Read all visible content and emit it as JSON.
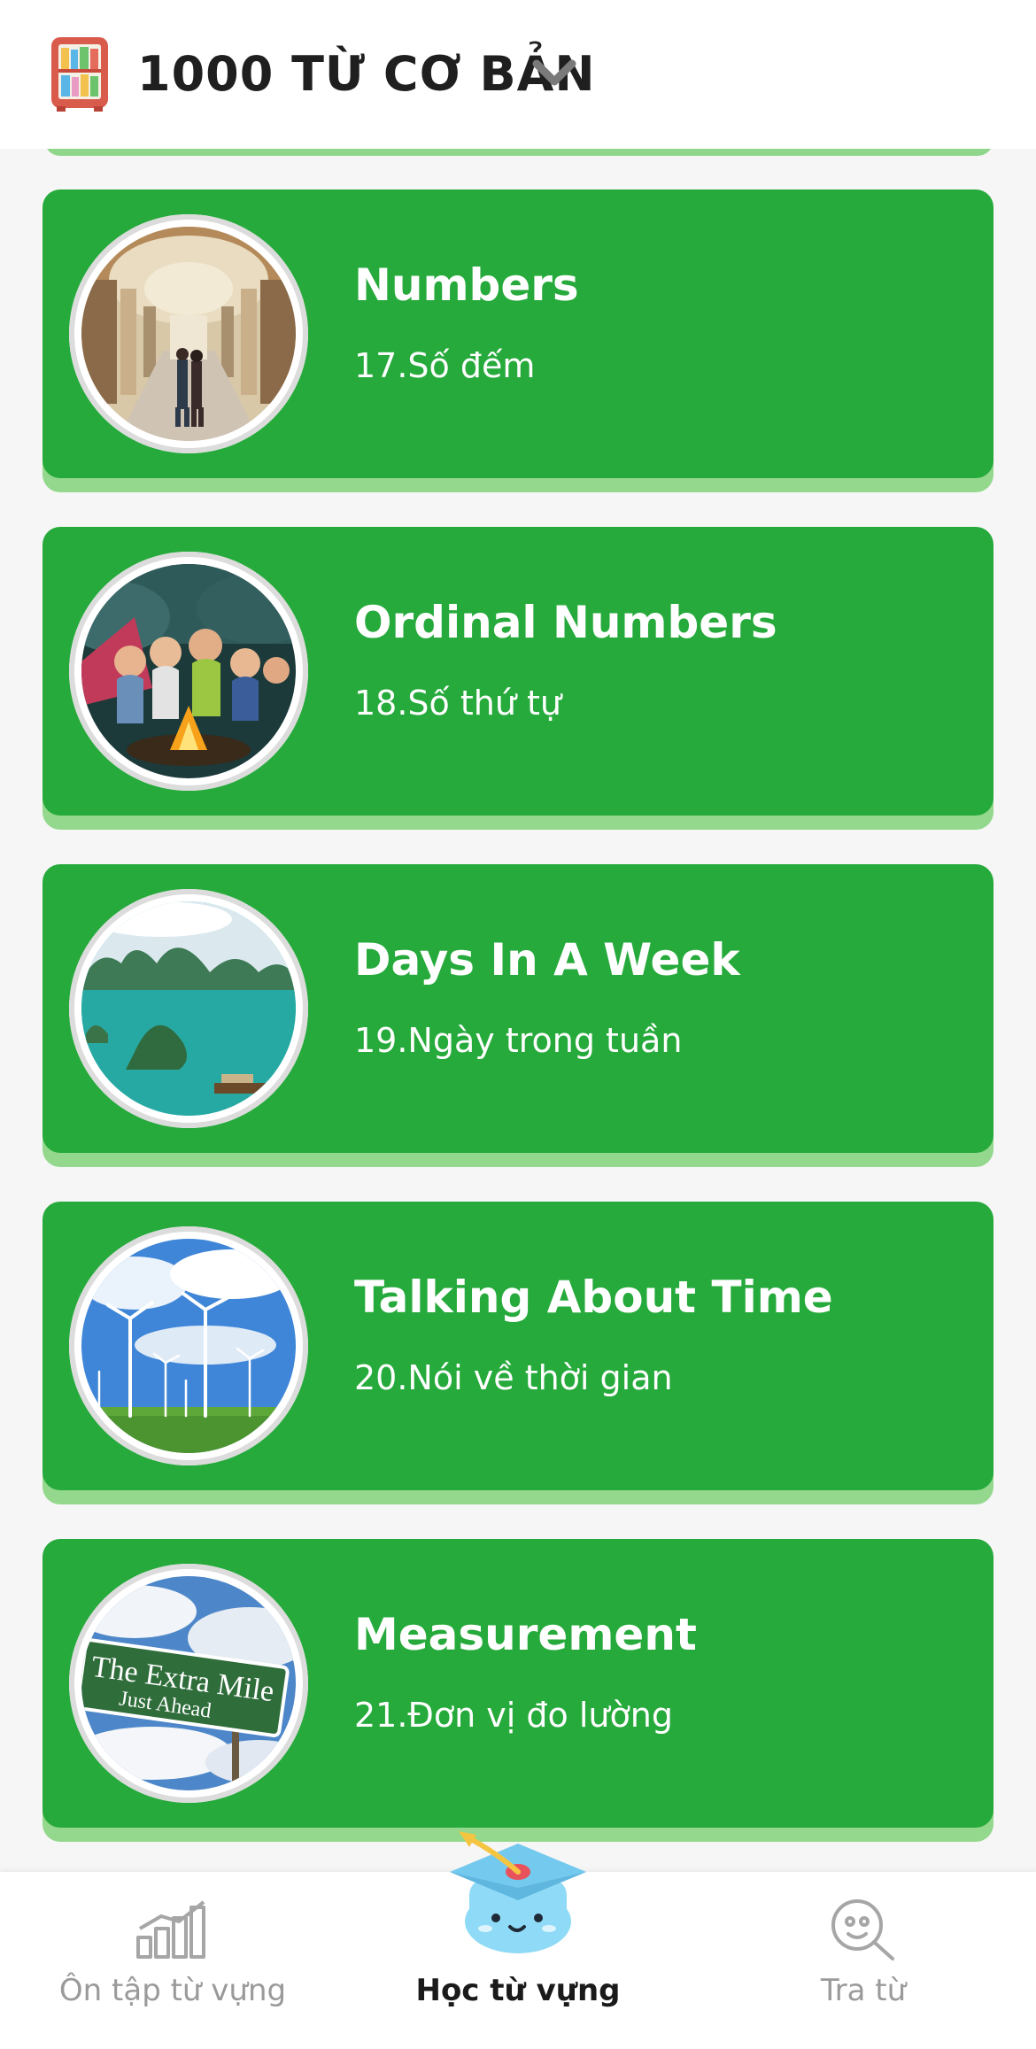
{
  "header": {
    "title": "1000 TỪ CƠ BẢN",
    "logo_icon": "bookshelf-icon",
    "dropdown_icon": "chevron-down-icon"
  },
  "lessons": [
    {
      "title": "Numbers",
      "subtitle": "17.Số đếm",
      "image": "museum-gallery-photo"
    },
    {
      "title": "Ordinal Numbers",
      "subtitle": "18.Số thứ tự",
      "image": "campfire-kids-photo"
    },
    {
      "title": "Days In A Week",
      "subtitle": "19.Ngày trong tuần",
      "image": "ha-long-bay-photo"
    },
    {
      "title": "Talking About Time",
      "subtitle": "20.Nói về thời gian",
      "image": "wind-turbines-photo"
    },
    {
      "title": "Measurement",
      "subtitle": "21.Đơn vị đo lường",
      "image": "extra-mile-sign-photo",
      "sign_line1": "The Extra Mile",
      "sign_line2": "Just Ahead"
    }
  ],
  "tabs": [
    {
      "label": "Ôn tập từ vựng",
      "icon": "bar-chart-icon",
      "active": false
    },
    {
      "label": "Học từ vựng",
      "icon": "graduation-cap-mascot-icon",
      "active": true
    },
    {
      "label": "Tra từ",
      "icon": "search-icon",
      "active": false
    }
  ],
  "colors": {
    "card_green": "#26aa3b",
    "card_shadow": "#93d88d",
    "background": "#f6f6f6",
    "tab_inactive": "#9a9a9a",
    "tab_active": "#1a1a1a",
    "mascot_blue": "#7fd3f2"
  }
}
